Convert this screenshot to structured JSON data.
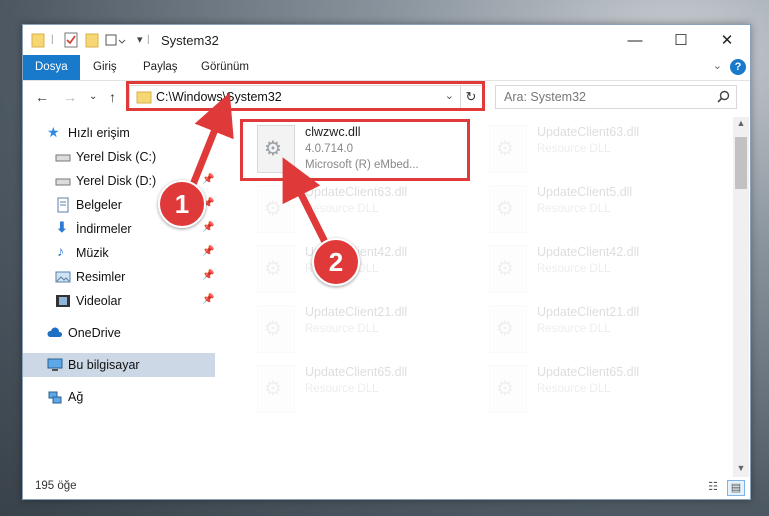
{
  "window": {
    "title": "System32"
  },
  "ribbon": {
    "tabs": [
      "Dosya",
      "Giriş",
      "Paylaş",
      "Görünüm"
    ]
  },
  "nav": {
    "address": "C:\\Windows\\System32",
    "search_placeholder": "Ara: System32"
  },
  "sidebar": {
    "items": [
      {
        "label": "Hızlı erişim",
        "icon": "star-icon"
      },
      {
        "label": "Yerel Disk (C:)",
        "icon": "drive-icon"
      },
      {
        "label": "Yerel Disk (D:)",
        "icon": "drive-icon"
      },
      {
        "label": "Belgeler",
        "icon": "document-icon"
      },
      {
        "label": "İndirmeler",
        "icon": "download-icon"
      },
      {
        "label": "Müzik",
        "icon": "music-icon"
      },
      {
        "label": "Resimler",
        "icon": "pictures-icon"
      },
      {
        "label": "Videolar",
        "icon": "video-icon"
      },
      {
        "label": "OneDrive",
        "icon": "cloud-icon"
      },
      {
        "label": "Bu bilgisayar",
        "icon": "computer-icon"
      },
      {
        "label": "Ağ",
        "icon": "network-icon"
      }
    ]
  },
  "files": [
    {
      "name": "clwzwc.dll",
      "line2": "4.0.714.0",
      "line3": "Microsoft (R) eMbed..."
    },
    {
      "name": "UpdateClient63.dll",
      "line2": "Resource DLL"
    },
    {
      "name": "UpdateClient63.dll",
      "line2": "Resource DLL"
    },
    {
      "name": "UpdateClient5.dll",
      "line2": "Resource DLL"
    },
    {
      "name": "UpdateClient42.dll",
      "line2": "Resource DLL"
    },
    {
      "name": "UpdateClient42.dll",
      "line2": "Resource DLL"
    },
    {
      "name": "UpdateClient21.dll",
      "line2": "Resource DLL"
    },
    {
      "name": "UpdateClient21.dll",
      "line2": "Resource DLL"
    },
    {
      "name": "UpdateClient65.dll",
      "line2": "Resource DLL"
    },
    {
      "name": "UpdateClient65.dll",
      "line2": "Resource DLL"
    }
  ],
  "status": {
    "count": "195 öğe"
  },
  "annotations": {
    "step1": "1",
    "step2": "2"
  },
  "colors": {
    "accent": "#1979ca",
    "annotation": "#e0393a"
  }
}
